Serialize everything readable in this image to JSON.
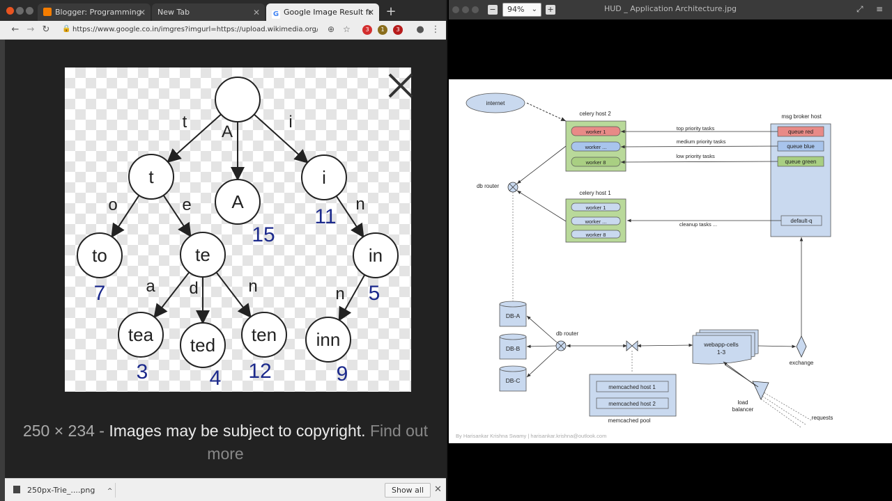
{
  "chrome": {
    "tabs": [
      {
        "label": "Blogger: Programming Cr",
        "active": false
      },
      {
        "label": "New Tab",
        "active": false
      },
      {
        "label": "Google Image Result for h",
        "active": true
      }
    ],
    "url": "https://www.google.co.in/imgres?imgurl=https://upload.wikimedia.org/wikipe...",
    "extension_badges": [
      "3",
      "1",
      "3"
    ],
    "caption": {
      "dimensions": "250 × 234",
      "separator": "-",
      "notice": "Images may be subject to copyright.",
      "link": "Find out more"
    },
    "download": {
      "filename": "250px-Trie_....png",
      "show_all": "Show all"
    }
  },
  "trie": {
    "nodes": [
      {
        "label": "",
        "value": ""
      },
      {
        "label": "t",
        "value": ""
      },
      {
        "label": "A",
        "value": "15"
      },
      {
        "label": "i",
        "value": "11"
      },
      {
        "label": "to",
        "value": "7"
      },
      {
        "label": "te",
        "value": ""
      },
      {
        "label": "in",
        "value": "5"
      },
      {
        "label": "tea",
        "value": "3"
      },
      {
        "label": "ted",
        "value": "4"
      },
      {
        "label": "ten",
        "value": "12"
      },
      {
        "label": "inn",
        "value": "9"
      }
    ],
    "edges": [
      {
        "label": "t"
      },
      {
        "label": "A"
      },
      {
        "label": "i"
      },
      {
        "label": "o"
      },
      {
        "label": "e"
      },
      {
        "label": "n"
      },
      {
        "label": "a"
      },
      {
        "label": "d"
      },
      {
        "label": "n"
      },
      {
        "label": "n"
      }
    ]
  },
  "viewer": {
    "zoom": "94%",
    "title": "HUD _ Application Architecture.jpg"
  },
  "diagram": {
    "internet": "internet",
    "celery_host_2": {
      "title": "celery host 2",
      "workers": [
        "worker 1",
        "worker ...",
        "worker 8"
      ]
    },
    "celery_host_1": {
      "title": "celery host 1",
      "workers": [
        "worker 1",
        "worker ...",
        "worker 8"
      ]
    },
    "broker": {
      "title": "msg broker host",
      "queues": [
        "queue red",
        "queue blue",
        "queue green"
      ],
      "default_q": "default-q"
    },
    "task_labels": [
      "top priority tasks",
      "medium priority tasks",
      "low priority  tasks",
      "cleanup tasks ..."
    ],
    "db_router_top": "db router",
    "db_router_bottom": "db router",
    "dbs": [
      "DB-A",
      "DB-B",
      "DB-C"
    ],
    "webapp": [
      "webapp-cells",
      "1-3"
    ],
    "exchange": "exchange",
    "memcached": {
      "hosts": [
        "memcached host 1",
        "memcached host 2"
      ],
      "pool": "memcached pool"
    },
    "load_balancer": [
      "load",
      "balancer"
    ],
    "requests": "requests",
    "credit": "By Harisankar Krishna Swamy | harisankar.krishna@outlook.com"
  },
  "colors": {
    "queue_red": "#e88a87",
    "queue_blue": "#a8c4ec",
    "queue_green": "#a9cf82",
    "celery_host_bg": "#b9d99a",
    "broker_bg": "#c9d9ef",
    "db_bg": "#c9d9ef",
    "trie_value": "#1c2a8c"
  }
}
